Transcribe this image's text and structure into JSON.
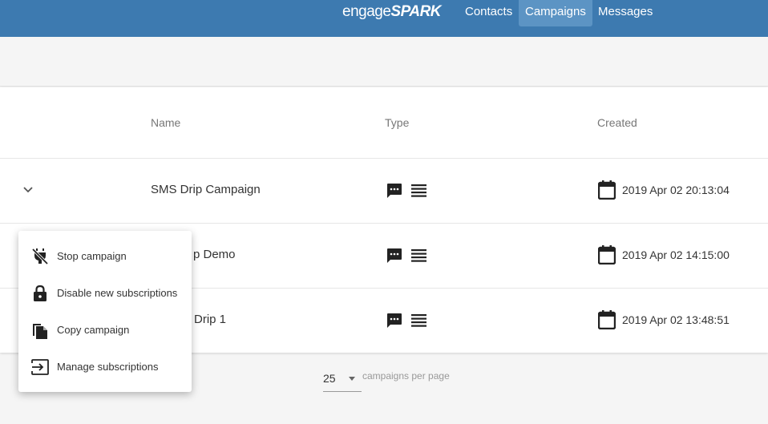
{
  "topbar": {
    "logo_prefix": "engage",
    "logo_suffix": "SPARK",
    "tabs": [
      {
        "label": "Contacts",
        "active": false
      },
      {
        "label": "Campaigns",
        "active": true
      },
      {
        "label": "Messages",
        "active": false
      }
    ],
    "bar_color": "#3d7ab0",
    "active_tab_color": "#5c94c4"
  },
  "table": {
    "headers": {
      "name": "Name",
      "type": "Type",
      "created": "Created"
    },
    "rows": [
      {
        "name": "SMS Drip Campaign",
        "created": "2019 Apr 02 20:13:04"
      },
      {
        "name": "p Demo",
        "created": "2019 Apr 02 14:15:00"
      },
      {
        "name": "Drip 1",
        "created": "2019 Apr 02 13:48:51"
      }
    ]
  },
  "pager": {
    "value": "25",
    "label": "campaigns per page"
  },
  "context_menu": {
    "items": [
      {
        "label": "Stop campaign",
        "icon": "stop-campaign-icon"
      },
      {
        "label": "Disable new subscriptions",
        "icon": "lock-icon"
      },
      {
        "label": "Copy campaign",
        "icon": "copy-icon"
      },
      {
        "label": "Manage subscriptions",
        "icon": "manage-subscriptions-icon"
      }
    ]
  }
}
